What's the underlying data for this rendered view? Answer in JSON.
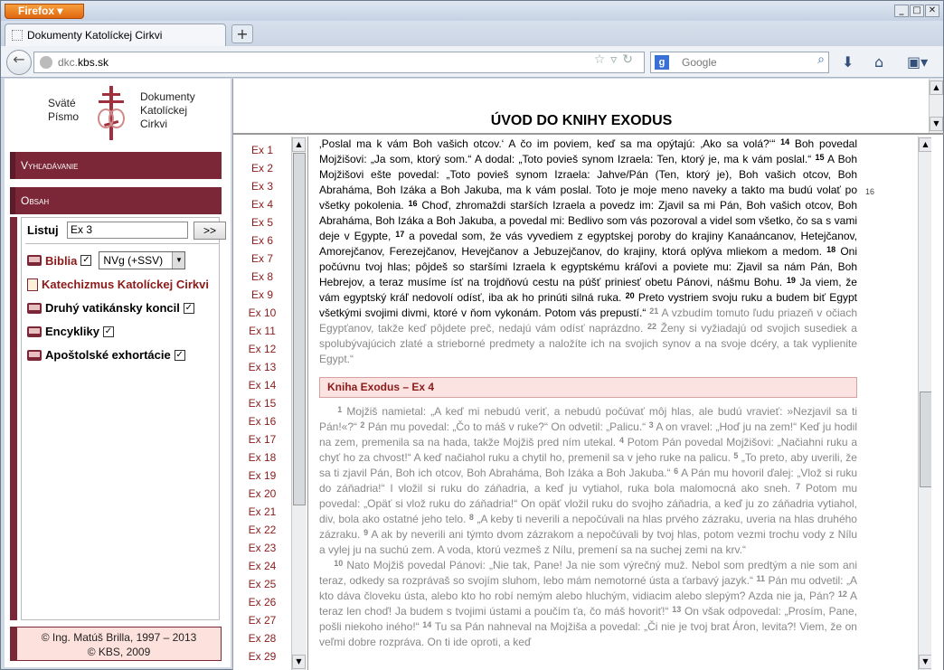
{
  "browser": {
    "app_button": "Firefox",
    "tab_title": "Dokumenty Katolíckej Cirkvi",
    "new_tab": "+",
    "url_domain_prefix": "dkc.",
    "url_domain": "kbs.sk",
    "search_placeholder": "Google",
    "search_engine_letter": "g"
  },
  "logo": {
    "left_line1": "Sväté",
    "left_line2": "Písmo",
    "right_line1": "Dokumenty",
    "right_line2": "Katolíckej",
    "right_line3": "Cirkvi"
  },
  "sidebar": {
    "search_header": "Vyhľadávanie",
    "content_header": "Obsah",
    "listuj_label": "Listuj",
    "listuj_value": "Ex 3",
    "go_button": ">>",
    "items": [
      {
        "label": "Biblia",
        "checked": true,
        "select": "NVg (+SSV)",
        "color": "#8b1a1a"
      },
      {
        "label": "Katechizmus Katolíckej Cirkvi",
        "color": "#8b1a1a"
      },
      {
        "label": "Druhý vatikánsky koncil",
        "checked": true
      },
      {
        "label": "Encykliky",
        "checked": true
      },
      {
        "label": "Apoštolské exhortácie",
        "checked": true
      }
    ],
    "copyright_line1": "© Ing. Matúš Brilla, 1997 – 2013",
    "copyright_line2": "© KBS, 2009"
  },
  "main": {
    "page_title": "ÚVOD DO KNIHY EXODUS",
    "chapters": [
      "Ex 1",
      "Ex 2",
      "Ex 3",
      "Ex 4",
      "Ex 5",
      "Ex 6",
      "Ex 7",
      "Ex 8",
      "Ex 9",
      "Ex 10",
      "Ex 11",
      "Ex 12",
      "Ex 13",
      "Ex 14",
      "Ex 15",
      "Ex 16",
      "Ex 17",
      "Ex 18",
      "Ex 19",
      "Ex 20",
      "Ex 21",
      "Ex 22",
      "Ex 23",
      "Ex 24",
      "Ex 25",
      "Ex 26",
      "Ex 27",
      "Ex 28",
      "Ex 29"
    ],
    "side_number": "16",
    "chapter_header": "Kniha Exodus   –   Ex 4",
    "colors": {
      "accent": "#7b2737",
      "link": "#8b1a1a",
      "chapter_bg": "#fbe3e2",
      "faded_text": "#888888"
    }
  }
}
